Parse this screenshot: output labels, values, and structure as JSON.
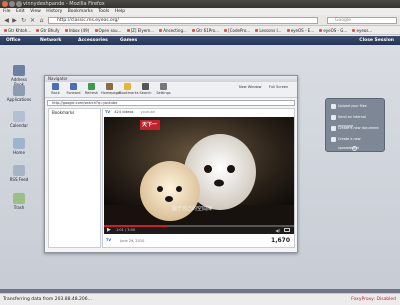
{
  "window": {
    "title": "vinnydeshpande - Mozilla Firefox"
  },
  "menubar": [
    "File",
    "Edit",
    "View",
    "History",
    "Bookmarks",
    "Tools",
    "Help"
  ],
  "navbar": {
    "url": "http://classic.ms.eyeos.org/",
    "search_placeholder": "Google"
  },
  "bookmarks": [
    "Gtr Khtoh...",
    "Gtr Bhufy",
    "Inbox (49)",
    "Open sou...",
    "[Z] Elyem...",
    "Ansecting...",
    "Gtr 61Pro...",
    "[CodePro...",
    "Lessons I...",
    "eyeOS - E...",
    "eyeOS - G...",
    "eyeos..."
  ],
  "eyeos_bar": {
    "items": [
      "Office",
      "Network",
      "Accessories",
      "Games"
    ],
    "user": "Close Session"
  },
  "desktop_icons": [
    {
      "label": "Address Book",
      "color": "#6d7fa5"
    },
    {
      "label": "Applications",
      "color": "#8e9bb2"
    },
    {
      "label": "Calendar",
      "color": "#b3c0d3"
    },
    {
      "label": "Home",
      "color": "#9fb3cb"
    },
    {
      "label": "RSS Feed",
      "color": "#a7b4c4"
    },
    {
      "label": "Trash",
      "color": "#9bbf88"
    }
  ],
  "navigator": {
    "title": "Navigator",
    "toolbar": [
      "Back",
      "Forward",
      "Refresh",
      "Homepage",
      "Bookmarks",
      "Search",
      "Settings"
    ],
    "toolbar_right": [
      "New Window",
      "Full Screen"
    ],
    "url": "http://google.com/search?q=youtube",
    "sidebar_label": "Bookmarks",
    "yt_stats": "424 videos",
    "yt_small": "youtube",
    "video_caption": "天下一",
    "video_subtitle": "屬于自己的空間陣",
    "time": "1:01 / 3:00",
    "progress": 0.33,
    "views": "1,670",
    "date": "June 29, 2010"
  },
  "panel": {
    "items": [
      "Upload your files",
      "Send an internal message",
      "Create a new document",
      "Create a new spreadsheet"
    ]
  },
  "statusbar": {
    "left": "Transferring data from 203.88.48.206...",
    "right": "FoxyProxy: Disabled"
  },
  "colors": {
    "eyeos_bar": "#2e3f62",
    "youtube_red": "#d71920",
    "panel": "#7d8796"
  }
}
